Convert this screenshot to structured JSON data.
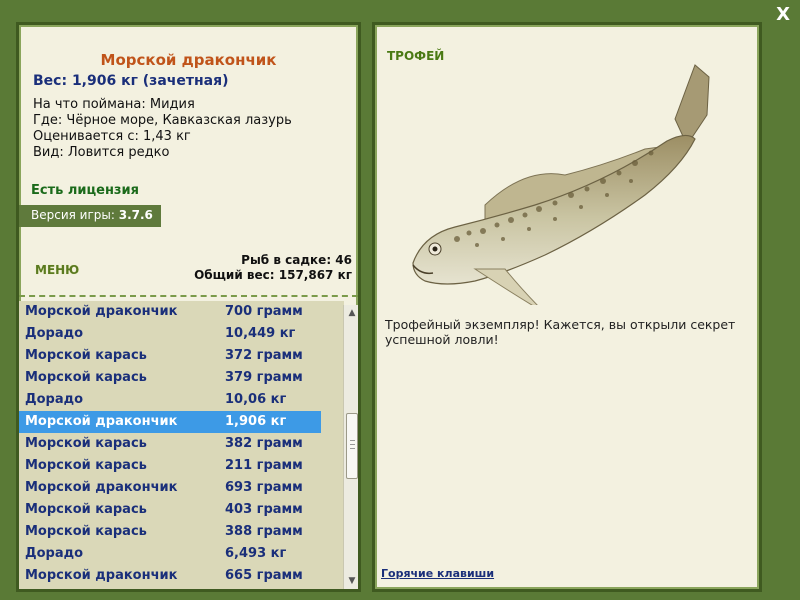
{
  "close_label": "X",
  "fish": {
    "name": "Морской дракончик",
    "weight_line": "Вес: 1,906 кг (зачетная)",
    "bait_line": "На что поймана: Мидия",
    "location_line": "Где: Чёрное море, Кавказская лазурь",
    "value_line": "Оценивается с: 1,43 кг",
    "kind_line": "Вид: Ловится редко"
  },
  "license": "Есть лицензия",
  "version": {
    "label": "Версия игры:",
    "value": "3.7.6"
  },
  "menu_label": "МЕНЮ",
  "stats": {
    "count_line": "Рыб в садке: 46",
    "total_line": "Общий вес: 157,867 кг"
  },
  "catch_list": [
    {
      "name": "Морской дракончик",
      "weight": "700 грамм"
    },
    {
      "name": "Дорадо",
      "weight": "10,449 кг"
    },
    {
      "name": "Морской карась",
      "weight": "372 грамм"
    },
    {
      "name": "Морской карась",
      "weight": "379 грамм"
    },
    {
      "name": "Дорадо",
      "weight": "10,06 кг"
    },
    {
      "name": "Морской дракончик",
      "weight": "1,906 кг",
      "selected": true
    },
    {
      "name": "Морской карась",
      "weight": "382 грамм"
    },
    {
      "name": "Морской карась",
      "weight": "211 грамм"
    },
    {
      "name": "Морской дракончик",
      "weight": "693 грамм"
    },
    {
      "name": "Морской карась",
      "weight": "403 грамм"
    },
    {
      "name": "Морской карась",
      "weight": "388 грамм"
    },
    {
      "name": "Дорадо",
      "weight": "6,493 кг"
    },
    {
      "name": "Морской дракончик",
      "weight": "665 грамм"
    }
  ],
  "trophy_label": "ТРОФЕЙ",
  "description": "Трофейный экземпляр! Кажется, вы открыли секрет успешной ловли!",
  "hotkeys_label": "Горячие клавиши",
  "colors": {
    "background": "#5a7a36",
    "panel": "#f3f1e0",
    "selection": "#3d9ae6",
    "fish_name": "#c0541a",
    "link": "#1a2f7a"
  },
  "icons": [
    "close-icon",
    "scroll-up-arrow-icon",
    "scroll-down-arrow-icon",
    "fish-image"
  ]
}
